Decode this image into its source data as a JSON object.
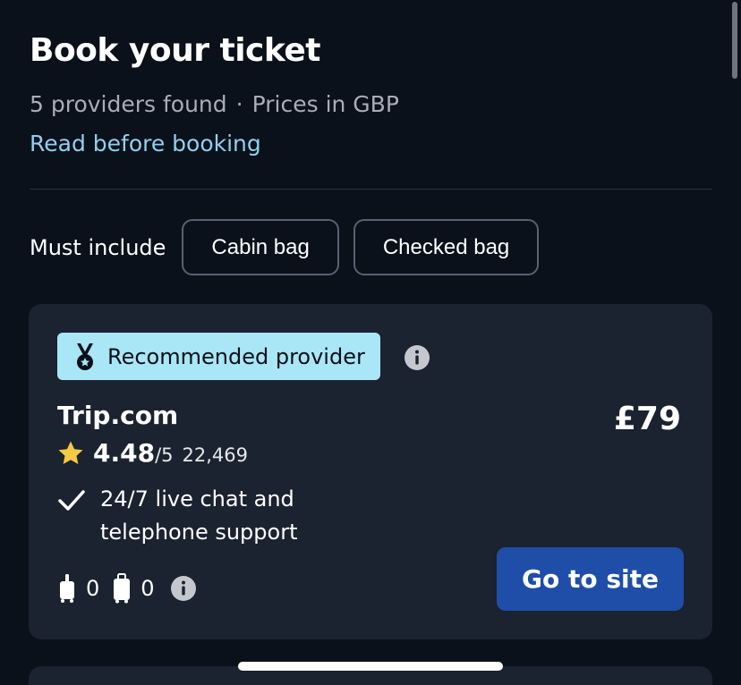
{
  "header": {
    "title": "Book your ticket",
    "providers_found": "5 providers found",
    "separator": "·",
    "prices_in": "Prices in GBP",
    "read_link": "Read before booking"
  },
  "filters": {
    "label": "Must include",
    "chips": [
      "Cabin bag",
      "Checked bag"
    ]
  },
  "provider_card": {
    "badge_label": "Recommended provider",
    "badge_icon": "medal-icon",
    "name": "Trip.com",
    "rating_value": "4.48",
    "rating_max": "/5",
    "rating_count": "22,469",
    "feature": "24/7 live chat and telephone support",
    "cabin_bag_count": "0",
    "checked_bag_count": "0",
    "price": "£79",
    "cta_label": "Go to site"
  },
  "colors": {
    "background": "#0b111b",
    "card": "#1b2230",
    "link": "#8fd0ee",
    "badge": "#a9e6f6",
    "cta": "#1f4ea9",
    "star": "#f6c945"
  }
}
